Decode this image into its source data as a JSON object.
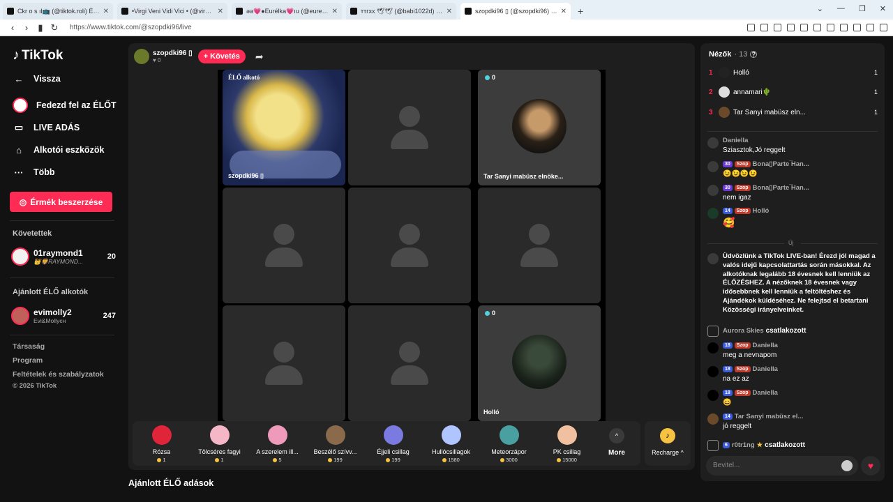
{
  "browser": {
    "tabs": [
      {
        "label": "Ckr o s ıl📺 (@tiktok.roli) ÉLŐ adá"
      },
      {
        "label": "•Virgi Veni Vidi Vici • (@virgivenivid"
      },
      {
        "label": "ǝǝ💗●Eurélka💗ıu (@eurekaeurek"
      },
      {
        "label": "ттгхх 🕊🕊 (@babi1022d) ÉLŐ adásba"
      },
      {
        "label": "szopdki96 ▯ (@szopdki96) ÉL"
      }
    ],
    "url": "https://www.tiktok.com/@szopdki96/live"
  },
  "sidebar": {
    "brand": "TikTok",
    "back": "Vissza",
    "explore": "Fedezd fel az ÉLŐT",
    "live": "LIVE ADÁS",
    "creator_tools": "Alkotói eszközök",
    "more": "Több",
    "coin_button": "Érmék beszerzése",
    "following_title": "Követettek",
    "following": [
      {
        "name": "01raymond1",
        "sub": "👑🦁RAYMOND...",
        "count": "20"
      }
    ],
    "recommended_title": "Ajánlott ÉLŐ alkotók",
    "recommended": [
      {
        "name": "evimolly2",
        "sub": "Evi&Mollyєн",
        "count": "247"
      }
    ],
    "links": [
      "Társaság",
      "Program",
      "Feltételek és szabályzatok",
      "© 2026 TikTok"
    ]
  },
  "stream": {
    "host_name": "szopdki96 ▯",
    "host_likes": "0",
    "follow_label": "+ Követés",
    "creator_tag": "ÉLŐ alkotó",
    "host_cell_name": "szopdki96 ▯",
    "guest1_name": "Tar Sanyi mabüsz elnöke...",
    "guest1_count": "0",
    "guest2_name": "Holló",
    "guest2_count": "0"
  },
  "gifts": [
    {
      "name": "Rózsa",
      "price": "1",
      "color": "#e0243a"
    },
    {
      "name": "Tölcséres fagyi",
      "price": "1",
      "color": "#f5b6c8"
    },
    {
      "name": "A szerelem ill...",
      "price": "5",
      "color": "#f09abb"
    },
    {
      "name": "Beszélő szívv...",
      "price": "199",
      "color": "#8a6a4a"
    },
    {
      "name": "Éjjeli csillag",
      "price": "199",
      "color": "#7a7ae0"
    },
    {
      "name": "Hullócsillagok",
      "price": "1580",
      "color": "#b0c4ff"
    },
    {
      "name": "Meteorzápor",
      "price": "3000",
      "color": "#4aa0a0"
    },
    {
      "name": "PK csillag",
      "price": "15000",
      "color": "#f0c0a0"
    }
  ],
  "more_label": "More",
  "recharge_label": "Recharge ^",
  "recommended_heading": "Ajánlott ÉLŐ adások",
  "chat": {
    "viewers_title": "Nézők",
    "viewers_count": "· 13",
    "viewers": [
      {
        "rank": "1",
        "name": "Holló",
        "value": "1"
      },
      {
        "rank": "2",
        "name": "annamari🌵",
        "value": "1"
      },
      {
        "rank": "3",
        "name": "Tar Sanyi mabüsz eln...",
        "value": "1"
      }
    ],
    "new_label": "Új",
    "messages_top": [
      {
        "name": "Daniella",
        "text": "Sziasztok,Jó reggelt"
      },
      {
        "lvl": "30",
        "tag": "Szop",
        "name": "Bona▯Parte ̅Han...",
        "text": "😉😉😉😉"
      },
      {
        "lvl": "30",
        "tag": "Szop",
        "name": "Bona▯Parte ̅Han...",
        "text": "nem igaz"
      },
      {
        "lvl": "14",
        "tag": "Szop",
        "name": "Holló",
        "text": "🥰"
      }
    ],
    "system": "Üdvözlünk a TikTok LIVE-ban! Érezd jól magad a valós idejű kapcsolattartás során másokkal. Az alkotóknak legalább 18 évesnek kell lenniük az ÉLŐZÉSHEZ. A nézőknek 18 évesnek vagy idősebbnek kell lenniük a feltöltéshez és Ajándékok küldéséhez. Ne felejtsd el betartani Közösségi irányelveinket.",
    "join1_name": "Aurora Skies",
    "join_label": "csatlakozott",
    "messages": [
      {
        "lvl": "18",
        "tag": "Szop",
        "name": "Daniella",
        "text": "meg a nevnapom"
      },
      {
        "lvl": "18",
        "tag": "Szop",
        "name": "Daniella",
        "text": "na ez az"
      },
      {
        "lvl": "18",
        "tag": "Szop",
        "name": "Daniella",
        "text": "😄"
      },
      {
        "lvl": "14",
        "tag": "",
        "name": "Tar Sanyi mabüsz el...",
        "text": "jó reggelt"
      }
    ],
    "join2_lvl": "6",
    "join2_name": "r0tr1ng",
    "input_placeholder": "Bevitel..."
  }
}
